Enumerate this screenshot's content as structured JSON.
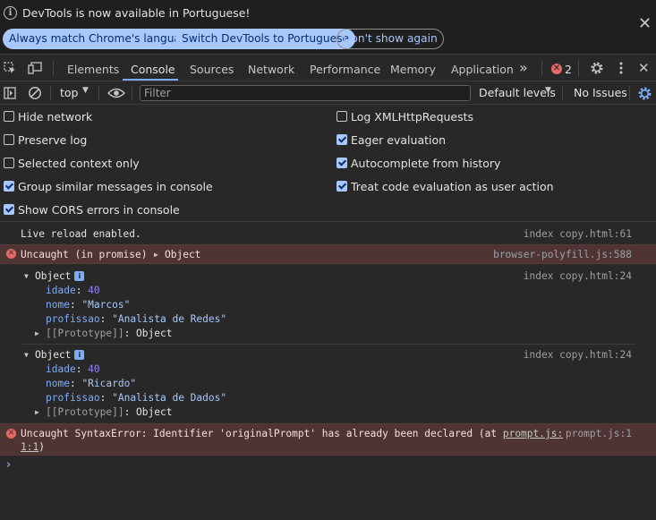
{
  "infobar": {
    "message": "DevTools is now available in Portuguese!",
    "buttons": [
      "Always match Chrome's language",
      "Switch DevTools to Portuguese",
      "Don't show again"
    ],
    "close_glyph": "✕"
  },
  "tabs": {
    "items": [
      "Elements",
      "Console",
      "Sources",
      "Network",
      "Performance",
      "Memory",
      "Application"
    ],
    "active": "Console",
    "overflow_glyph": "»",
    "error_count": "2"
  },
  "toolbar": {
    "context": "top",
    "filter_placeholder": "Filter",
    "levels": "Default levels",
    "issues": "No Issues"
  },
  "settings": {
    "left": [
      {
        "label": "Hide network",
        "checked": false
      },
      {
        "label": "Preserve log",
        "checked": false
      },
      {
        "label": "Selected context only",
        "checked": false
      },
      {
        "label": "Group similar messages in console",
        "checked": true
      },
      {
        "label": "Show CORS errors in console",
        "checked": true
      }
    ],
    "right": [
      {
        "label": "Log XMLHttpRequests",
        "checked": false
      },
      {
        "label": "Eager evaluation",
        "checked": true
      },
      {
        "label": "Autocomplete from history",
        "checked": true
      },
      {
        "label": "Treat code evaluation as user action",
        "checked": true
      }
    ]
  },
  "console": {
    "live_reload": {
      "text": "Live reload enabled.",
      "source": "index copy.html:61"
    },
    "promise_error": {
      "text": "Uncaught (in promise)",
      "object": "Object",
      "source": "browser-polyfill.js:588"
    },
    "object1": {
      "source": "index copy.html:24",
      "title": "Object",
      "fields": [
        {
          "key": "idade",
          "value": "40",
          "type": "number"
        },
        {
          "key": "nome",
          "value": "\"Marcos\"",
          "type": "string"
        },
        {
          "key": "profissao",
          "value": "\"Analista de Redes\"",
          "type": "string"
        }
      ],
      "proto_key": "[[Prototype]]",
      "proto_value": "Object"
    },
    "object2": {
      "source": "index copy.html:24",
      "title": "Object",
      "fields": [
        {
          "key": "idade",
          "value": "40",
          "type": "number"
        },
        {
          "key": "nome",
          "value": "\"Ricardo\"",
          "type": "string"
        },
        {
          "key": "profissao",
          "value": "\"Analista de Dados\"",
          "type": "string"
        }
      ],
      "proto_key": "[[Prototype]]",
      "proto_value": "Object"
    },
    "syntax_error": {
      "text": "Uncaught SyntaxError: Identifier 'originalPrompt' has already been declared (at ",
      "link": "prompt.js:",
      "link2": "1:1",
      "tail": ")",
      "source": "prompt.js:1"
    },
    "prompt_glyph": "›"
  },
  "colors": {
    "accent": "#a8c7fa",
    "error_bg": "#4e3534",
    "error_icon": "#e46962",
    "background": "#282828"
  }
}
